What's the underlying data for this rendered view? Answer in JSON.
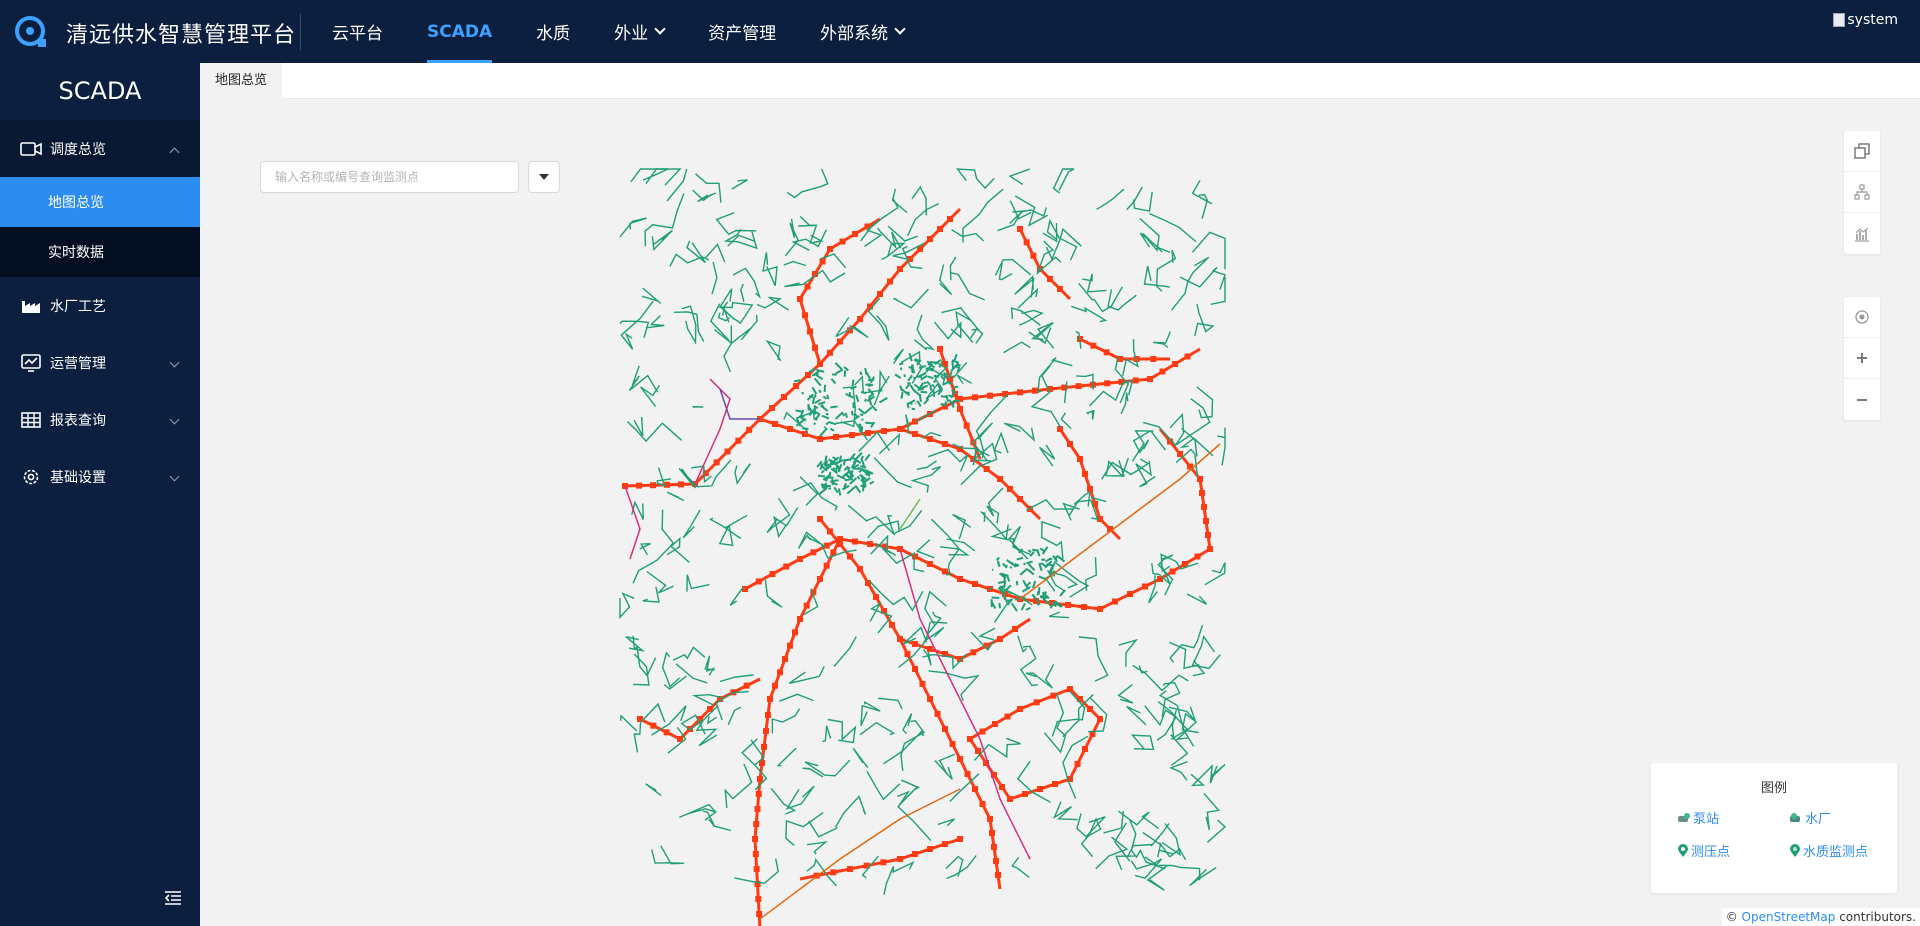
{
  "header": {
    "title": "清远供水智慧管理平台",
    "nav": [
      {
        "label": "云平台",
        "active": false,
        "dropdown": false
      },
      {
        "label": "SCADA",
        "active": true,
        "dropdown": false
      },
      {
        "label": "水质",
        "active": false,
        "dropdown": false
      },
      {
        "label": "外业",
        "active": false,
        "dropdown": true
      },
      {
        "label": "资产管理",
        "active": false,
        "dropdown": false
      },
      {
        "label": "外部系统",
        "active": false,
        "dropdown": true
      }
    ],
    "user_image_alt": "system"
  },
  "sidebar": {
    "title": "SCADA",
    "groups": [
      {
        "label": "调度总览",
        "icon": "video-camera-icon",
        "expanded": true,
        "children": [
          {
            "label": "地图总览",
            "active": true
          },
          {
            "label": "实时数据",
            "active": false
          }
        ]
      },
      {
        "label": "水厂工艺",
        "icon": "factory-icon",
        "expanded": false
      },
      {
        "label": "运营管理",
        "icon": "monitor-chart-icon",
        "expanded": false
      },
      {
        "label": "报表查询",
        "icon": "table-icon",
        "expanded": false
      },
      {
        "label": "基础设置",
        "icon": "gear-icon",
        "expanded": false
      }
    ]
  },
  "tabs": [
    {
      "label": "地图总览",
      "active": true
    }
  ],
  "search": {
    "placeholder": "输入名称或编号查询监测点",
    "value": ""
  },
  "map_tools": {
    "top": [
      "layers-icon",
      "org-tree-icon",
      "chart-icon"
    ],
    "bottom": [
      "locate-icon",
      "zoom-in-icon",
      "zoom-out-icon"
    ]
  },
  "legend": {
    "title": "图例",
    "items": [
      {
        "label": "泵站",
        "icon": "pump-station-icon"
      },
      {
        "label": "水厂",
        "icon": "water-plant-icon"
      },
      {
        "label": "测压点",
        "icon": "pressure-point-icon"
      },
      {
        "label": "水质监测点",
        "icon": "quality-point-icon"
      }
    ]
  },
  "attribution": {
    "prefix": "©",
    "link": "OpenStreetMap",
    "suffix": "contributors."
  },
  "colors": {
    "header_bg": "#0c1f3f",
    "active_blue": "#3ea0ff",
    "menu_active": "#2d8cf0",
    "pipe_green": "#1f9e77",
    "pipe_red": "#ff3b14",
    "pipe_orange": "#e06a10",
    "pipe_magenta": "#d4307e",
    "map_bg": "#f2f2f2"
  }
}
